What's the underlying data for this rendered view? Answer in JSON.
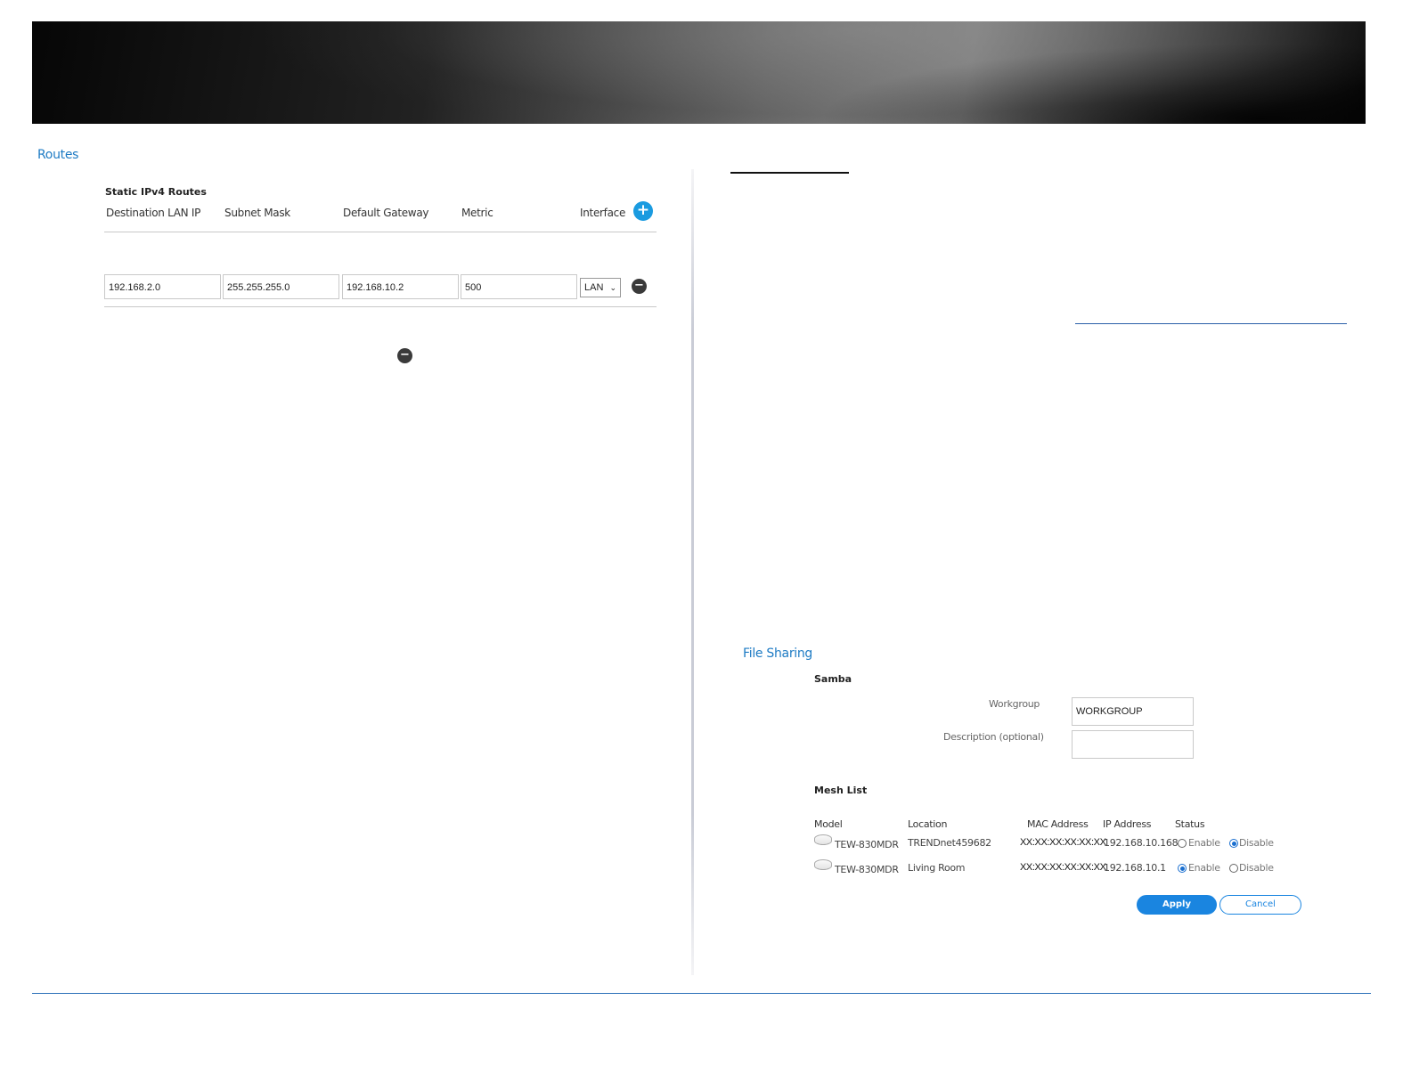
{
  "routes": {
    "section_title": "Routes",
    "table_title": "Static IPv4 Routes",
    "headers": [
      "Destination LAN IP",
      "Subnet Mask",
      "Default Gateway",
      "Metric",
      "Interface"
    ],
    "row": {
      "destination": "192.168.2.0",
      "subnet_mask": "255.255.255.0",
      "gateway": "192.168.10.2",
      "metric": "500",
      "interface": "LAN"
    },
    "add_icon": "plus-icon",
    "remove_icon": "minus-icon"
  },
  "file_sharing": {
    "section_title": "File Sharing",
    "samba_title": "Samba",
    "workgroup_label": "Workgroup",
    "workgroup_value": "WORKGROUP",
    "description_label": "Description (optional)",
    "description_value": "",
    "mesh_title": "Mesh List",
    "mesh_headers": [
      "Model",
      "Location",
      "MAC Address",
      "IP Address",
      "Status"
    ],
    "mesh_rows": [
      {
        "model": "TEW-830MDR",
        "location": "TRENDnet459682",
        "mac": "XX:XX:XX:XX:XX:XX",
        "ip": "192.168.10.168",
        "enable_label": "Enable",
        "disable_label": "Disable",
        "status": "Disable"
      },
      {
        "model": "TEW-830MDR",
        "location": "Living Room",
        "mac": "XX:XX:XX:XX:XX:XX",
        "ip": "192.168.10.1",
        "enable_label": "Enable",
        "disable_label": "Disable",
        "status": "Enable"
      }
    ],
    "apply_label": "Apply",
    "cancel_label": "Cancel"
  },
  "colors": {
    "accent": "#1a85e0",
    "section_title": "#1e7bc4",
    "footer_line": "#2a6fb8"
  }
}
